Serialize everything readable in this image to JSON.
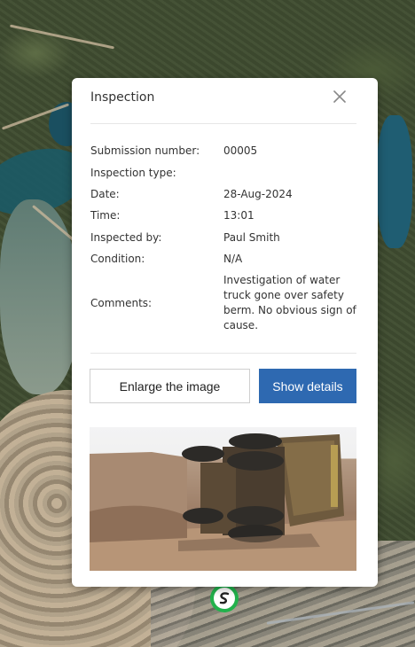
{
  "popup": {
    "title": "Inspection",
    "close_icon": "close-icon",
    "fields": [
      {
        "label": "Submission number:",
        "value": "00005"
      },
      {
        "label": "Inspection type:",
        "value": ""
      },
      {
        "label": "Date:",
        "value": "28-Aug-2024"
      },
      {
        "label": "Time:",
        "value": "13:01"
      },
      {
        "label": "Inspected by:",
        "value": "Paul Smith"
      },
      {
        "label": "Condition:",
        "value": "N/A"
      }
    ],
    "comments": {
      "label": "Comments:",
      "value": "Investigation of water truck gone over safety berm. No obvious sign of cause."
    },
    "buttons": {
      "enlarge": "Enlarge the image",
      "details": "Show details"
    },
    "photo_icon": "overturned-truck-photo"
  },
  "map": {
    "marker_icon": "inspection-marker-icon"
  },
  "colors": {
    "primary_button": "#2e69b1",
    "marker": "#22b14c"
  }
}
